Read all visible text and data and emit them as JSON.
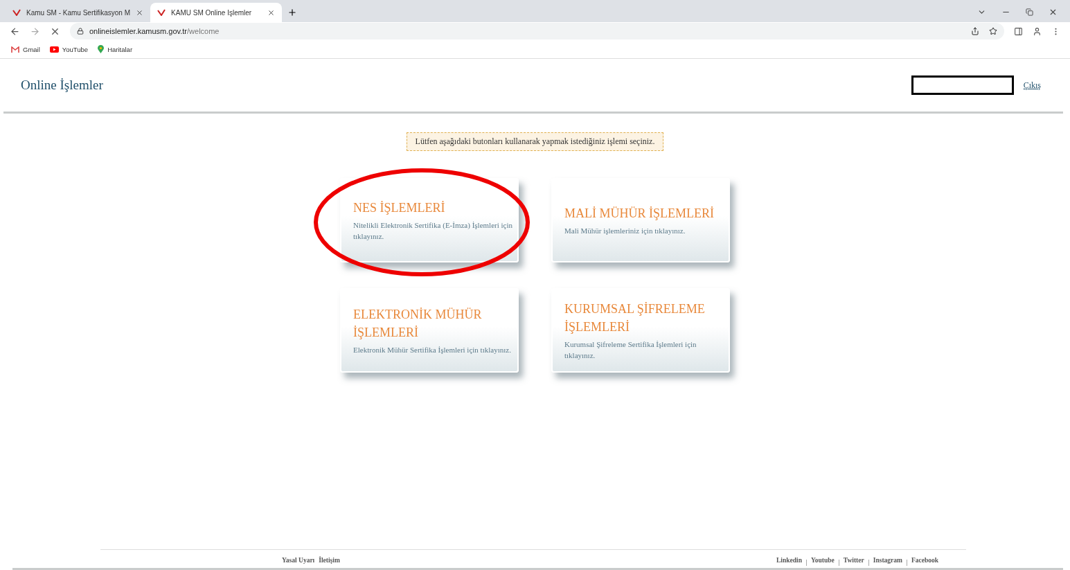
{
  "browser": {
    "tabs": [
      {
        "title": "Kamu SM - Kamu Sertifikasyon M",
        "selected": false
      },
      {
        "title": "KAMU SM Online İşlemler",
        "selected": true
      }
    ],
    "url_host": "onlineislemler.kamusm.gov.tr",
    "url_path": "/welcome",
    "bookmarks": [
      {
        "label": "Gmail",
        "kind": "gmail"
      },
      {
        "label": "YouTube",
        "kind": "youtube"
      },
      {
        "label": "Haritalar",
        "kind": "maps"
      }
    ]
  },
  "header": {
    "title": "Online İşlemler",
    "logout": "Çıkış"
  },
  "notice": "Lütfen aşağıdaki butonları kullanarak yapmak istediğiniz işlemi seçiniz.",
  "cards": [
    {
      "title": "NES İŞLEMLERİ",
      "description": "Nitelikli Elektronik Sertifika (E-İmza) İşlemleri için tıklayınız.",
      "highlighted": true
    },
    {
      "title": "MALİ MÜHÜR İŞLEMLERİ",
      "description": "Mali Mühür işlemleriniz için tıklayınız.",
      "highlighted": false
    },
    {
      "title": "ELEKTRONİK MÜHÜR İŞLEMLERİ",
      "description": "Elektronik Mühür Sertifika İşlemleri için tıklayınız.",
      "highlighted": false
    },
    {
      "title": "KURUMSAL ŞİFRELEME İŞLEMLERİ",
      "description": "Kurumsal Şifreleme Sertifika İşlemleri için tıklayınız.",
      "highlighted": false
    }
  ],
  "footer": {
    "left_links": [
      "Yasal Uyarı",
      "İletişim"
    ],
    "right_links": [
      "Linkedin",
      "Youtube",
      "Twitter",
      "Instagram",
      "Facebook"
    ]
  }
}
